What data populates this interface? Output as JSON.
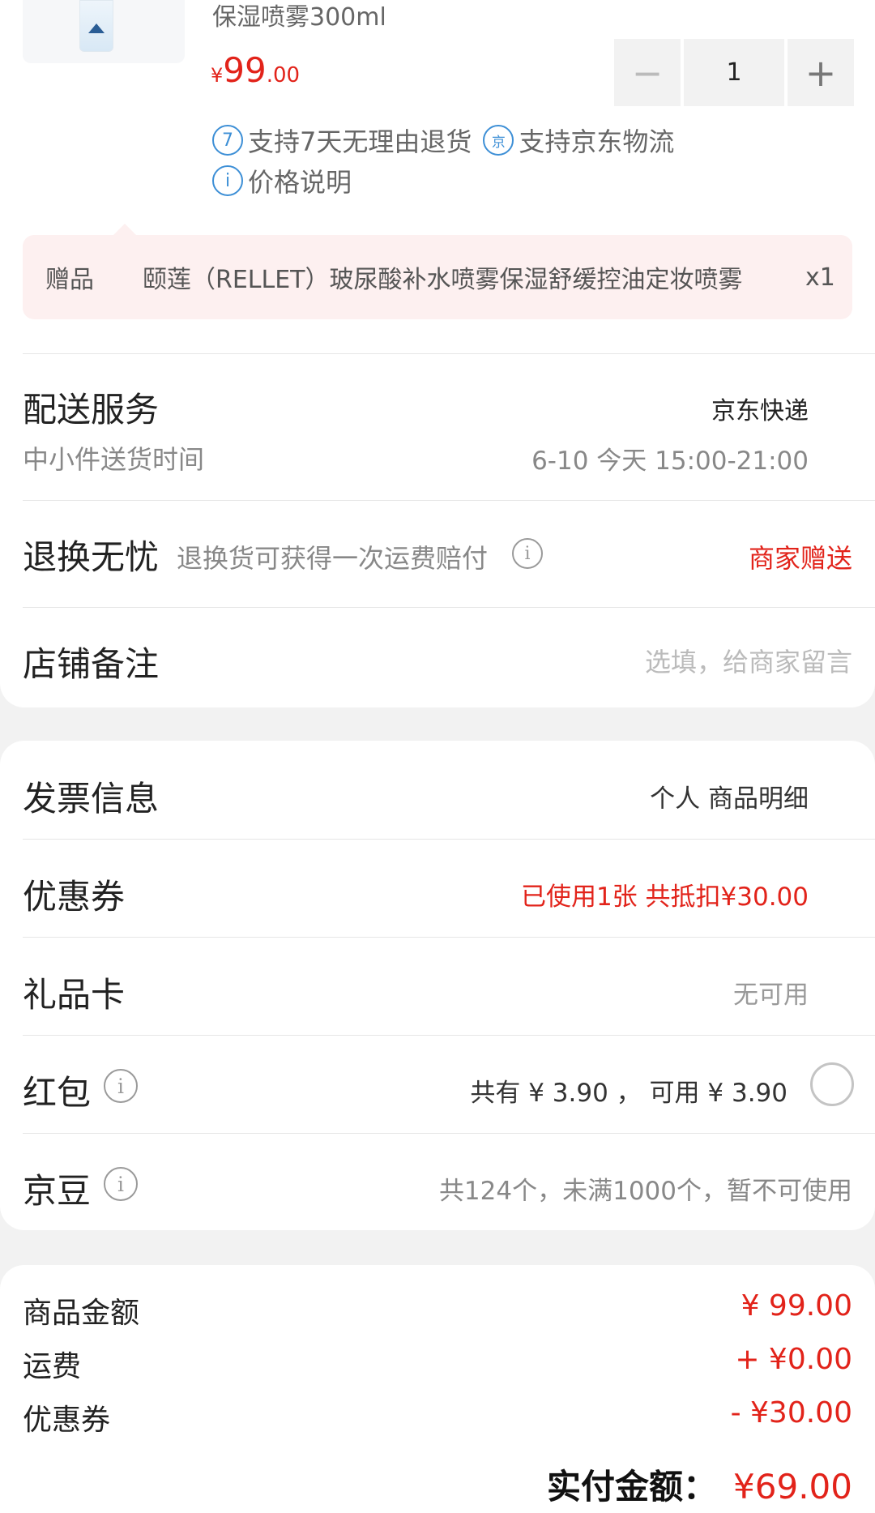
{
  "product": {
    "title": "保湿喷雾300ml",
    "price_symbol": "¥",
    "price_int": "99",
    "price_dec": ".00",
    "quantity": "1",
    "minus_label": "−",
    "plus_label": "+",
    "tags": [
      {
        "icon_text": "7",
        "label": "支持7天无理由退货"
      },
      {
        "icon_text": "京",
        "label": "支持京东物流"
      },
      {
        "icon_text": "i",
        "label": "价格说明"
      }
    ],
    "gift": {
      "label": "赠品",
      "name": "颐莲（RELLET）玻尿酸补水喷雾保湿舒缓控油定妆喷雾",
      "qty": "x1"
    }
  },
  "delivery": {
    "title": "配送服务",
    "carrier": "京东快递",
    "sub_label": "中小件送货时间",
    "time": "6-10 今天 15:00-21:00"
  },
  "return_service": {
    "title": "退换无忧",
    "desc": "退换货可获得一次运费赔付",
    "value": "商家赠送"
  },
  "store_note": {
    "title": "店铺备注",
    "placeholder": "选填，给商家留言"
  },
  "invoice": {
    "title": "发票信息",
    "value": "个人 商品明细"
  },
  "coupon": {
    "title": "优惠券",
    "value": "已使用1张 共抵扣¥30.00"
  },
  "gift_card": {
    "title": "礼品卡",
    "value": "无可用"
  },
  "red_packet": {
    "title": "红包",
    "value": "共有 ¥ 3.90 ， 可用 ¥ 3.90"
  },
  "jd_beans": {
    "title": "京豆",
    "value": "共124个，未满1000个，暂不可使用"
  },
  "summary": {
    "items": [
      {
        "label": "商品金额",
        "value": "¥ 99.00"
      },
      {
        "label": "运费",
        "value": "+ ¥0.00"
      },
      {
        "label": "优惠券",
        "value": "- ¥30.00"
      }
    ],
    "pay_label": "实付金额：",
    "pay_value": "¥69.00"
  },
  "icons": {
    "info": "info-circle-icon",
    "radio": "radio-unchecked-icon"
  },
  "colors": {
    "accent_red": "#e2231a",
    "tag_blue": "#3d8fd6",
    "gift_bg": "#fdf0f0"
  }
}
